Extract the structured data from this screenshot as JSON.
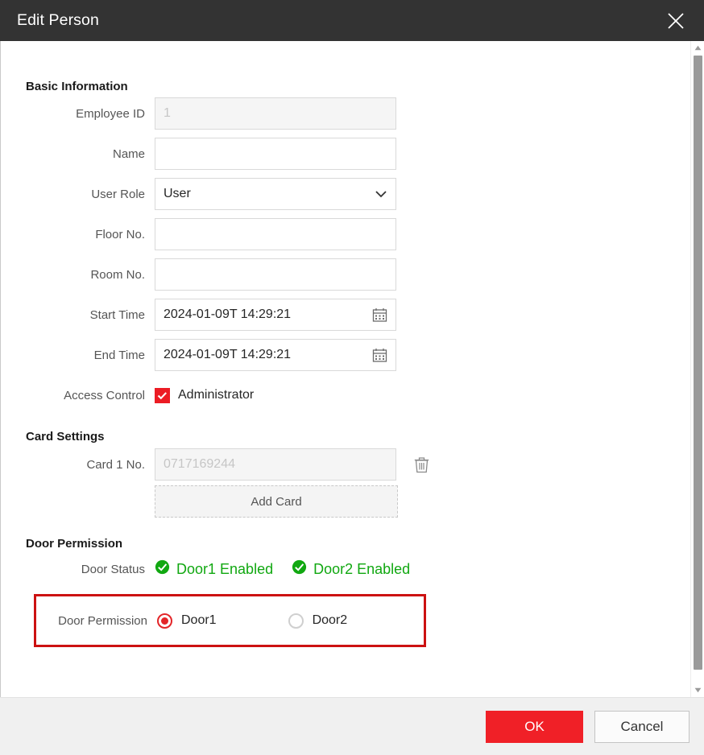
{
  "dialog": {
    "title": "Edit Person",
    "close_icon": "close-icon"
  },
  "sections": {
    "basic": "Basic Information",
    "card": "Card Settings",
    "door": "Door Permission"
  },
  "basic_information": {
    "employee_id": {
      "label": "Employee ID",
      "value": "",
      "placeholder": "1",
      "disabled": true
    },
    "name": {
      "label": "Name",
      "value": "",
      "placeholder": ""
    },
    "user_role": {
      "label": "User Role",
      "value": "User",
      "options": [
        "User"
      ],
      "icon": "chevron-down-icon"
    },
    "floor_no": {
      "label": "Floor No.",
      "value": "",
      "placeholder": ""
    },
    "room_no": {
      "label": "Room No.",
      "value": "",
      "placeholder": ""
    },
    "start_time": {
      "label": "Start Time",
      "value": "2024-01-09T 14:29:21",
      "icon": "calendar-icon"
    },
    "end_time": {
      "label": "End Time",
      "value": "2024-01-09T 14:29:21",
      "icon": "calendar-icon"
    },
    "access_control": {
      "label": "Access Control",
      "checkbox_label": "Administrator",
      "checked": true
    }
  },
  "card_settings": {
    "card1": {
      "label": "Card 1 No.",
      "value": "",
      "placeholder": "0717169244",
      "disabled": true,
      "delete_icon": "trash-icon"
    },
    "add_card_label": "Add Card"
  },
  "door_permission": {
    "status": {
      "label": "Door Status",
      "items": [
        {
          "text": "Door1 Enabled",
          "icon": "check-circle-icon"
        },
        {
          "text": "Door2 Enabled",
          "icon": "check-circle-icon"
        }
      ]
    },
    "permission": {
      "label": "Door Permission",
      "options": [
        {
          "label": "Door1",
          "selected": true
        },
        {
          "label": "Door2",
          "selected": false
        }
      ]
    }
  },
  "footer": {
    "ok_label": "OK",
    "cancel_label": "Cancel"
  },
  "scrollbar": {
    "up_icon": "caret-up-icon",
    "down_icon": "caret-down-icon"
  },
  "colors": {
    "header_bg": "#333333",
    "accent_red": "#ec1c24",
    "ok_red": "#f02027",
    "highlight_red": "#cc1111",
    "status_green": "#11a811",
    "footer_bg": "#f0f0f0"
  }
}
